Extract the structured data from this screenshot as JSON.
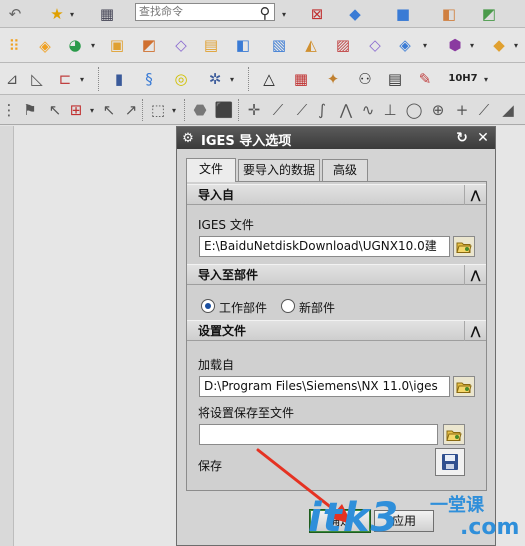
{
  "toolbar": {
    "command_search_placeholder": "查找命令",
    "colors": {
      "bar_bg": "#e6e6e6",
      "icon_orange": "#f0a020",
      "icon_blue": "#3a7bd5"
    }
  },
  "dialog": {
    "title": "IGES 导入选项",
    "tabs": [
      {
        "label": "文件",
        "active": true
      },
      {
        "label": "要导入的数据",
        "active": false
      },
      {
        "label": "高级",
        "active": false
      }
    ],
    "import_from": {
      "header": "导入自",
      "iges_file_label": "IGES 文件",
      "iges_file_value": "E:\\BaiduNetdiskDownload\\UGNX10.0建"
    },
    "import_to_part": {
      "header": "导入至部件",
      "options": [
        {
          "label": "工作部件",
          "selected": true
        },
        {
          "label": "新部件",
          "selected": false
        }
      ]
    },
    "settings_file": {
      "header": "设置文件",
      "load_from_label": "加载自",
      "load_from_value": "D:\\Program Files\\Siemens\\NX 11.0\\iges",
      "save_settings_label": "将设置保存至文件",
      "save_settings_value": "",
      "save_label": "保存"
    },
    "buttons": {
      "ok": "确定",
      "apply": "应用"
    },
    "colors": {
      "title_bar": "#3c3c3c",
      "ok_border": "#3c8a3c"
    }
  },
  "watermark": {
    "main": "itk3",
    "side": "一堂课",
    "domain": ".com"
  }
}
